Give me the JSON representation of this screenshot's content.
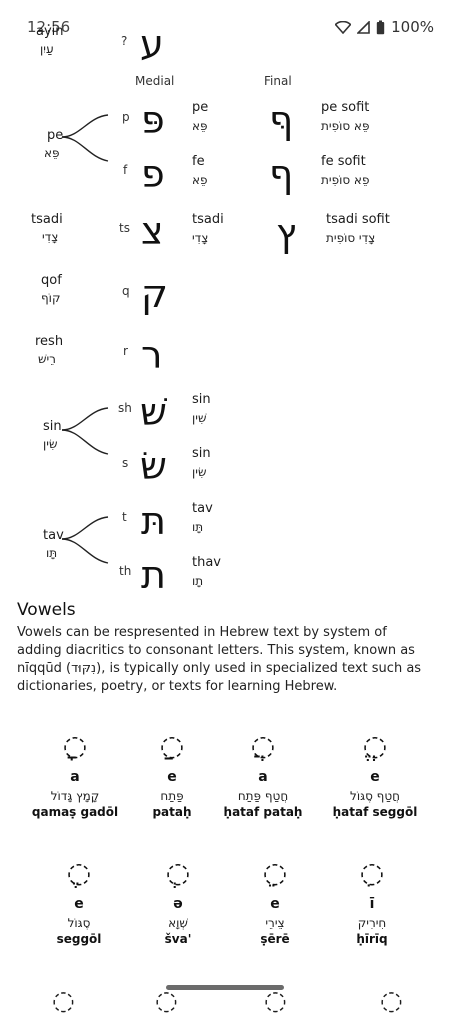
{
  "status": {
    "time": "12:56",
    "battery": "100%"
  },
  "top_partial": {
    "name": "ayin",
    "hebrew": "עַיִן",
    "translit": "?",
    "letter": "ע"
  },
  "columns": {
    "medial": "Medial",
    "final": "Final"
  },
  "letters": {
    "pe": {
      "name": "pe",
      "hebrew": "פֵּא",
      "medial_p": {
        "translit": "p",
        "glyph": "פּ",
        "name": "pe",
        "hebrew": "פֵּא",
        "final_glyph": "ףּ",
        "final_name": "pe sofit",
        "final_hebrew": "פֵּא סוֹפִית"
      },
      "medial_f": {
        "translit": "f",
        "glyph": "פ",
        "name": "fe",
        "hebrew": "פֵא",
        "final_glyph": "ף",
        "final_name": "fe sofit",
        "final_hebrew": "פֵא סוֹפִית"
      }
    },
    "tsadi": {
      "name": "tsadi",
      "hebrew": "צָדִי",
      "translit": "ts",
      "glyph": "צ",
      "medial_name": "tsadi",
      "medial_hebrew": "צָדִי",
      "final_glyph": "ץ",
      "final_name": "tsadi sofit",
      "final_hebrew": "צָדִי סוֹפִית"
    },
    "qof": {
      "name": "qof",
      "hebrew": "קוֹף",
      "translit": "q",
      "glyph": "ק"
    },
    "resh": {
      "name": "resh",
      "hebrew": "רֵישׁ",
      "translit": "r",
      "glyph": "ר"
    },
    "sin": {
      "name": "sin",
      "hebrew": "שִׂין",
      "sh": {
        "translit": "sh",
        "glyph": "שׁ",
        "name": "sin",
        "hebrew": "שִׁין"
      },
      "s": {
        "translit": "s",
        "glyph": "שׂ",
        "name": "sin",
        "hebrew": "שִׂין"
      }
    },
    "tav": {
      "name": "tav",
      "hebrew": "תָּו",
      "t": {
        "translit": "t",
        "glyph": "תּ",
        "name": "tav",
        "hebrew": "תָּו"
      },
      "th": {
        "translit": "th",
        "glyph": "ת",
        "name": "thav",
        "hebrew": "תָו"
      }
    }
  },
  "vowels_section": {
    "title": "Vowels",
    "text": "Vowels can be respresented in Hebrew text by system of adding diacritics to consonant letters. This system, known as nīqqūd (נִקּוּד), is typically only used in specialized text such as dictionaries, poetry, or texts for learning Hebrew.",
    "items": [
      {
        "glyph": "◌ָ",
        "sound": "a",
        "hebrew": "קָמָץ גָּדוֹל",
        "latin": "qamaṣ gadōl"
      },
      {
        "glyph": "◌ַ",
        "sound": "e",
        "hebrew": "פַּתַח",
        "latin": "pataḥ"
      },
      {
        "glyph": "◌ֲ",
        "sound": "a",
        "hebrew": "חֲטַף פַּתַח",
        "latin": "ḥataf pataḥ"
      },
      {
        "glyph": "◌ֱ",
        "sound": "e",
        "hebrew": "חֲטַף סֶגּוֹל",
        "latin": "ḥataf seggōl"
      },
      {
        "glyph": "◌ֶ",
        "sound": "e",
        "hebrew": "סֶגּוֹל",
        "latin": "seggōl"
      },
      {
        "glyph": "◌ְ",
        "sound": "ə",
        "hebrew": "שְׁוָא",
        "latin": "šva'"
      },
      {
        "glyph": "◌ֵ",
        "sound": "e",
        "hebrew": "צֵירֵי",
        "latin": "ṣērē"
      },
      {
        "glyph": "◌ִ",
        "sound": "ī",
        "hebrew": "חִירִיק",
        "latin": "ḥīrīq"
      }
    ]
  }
}
